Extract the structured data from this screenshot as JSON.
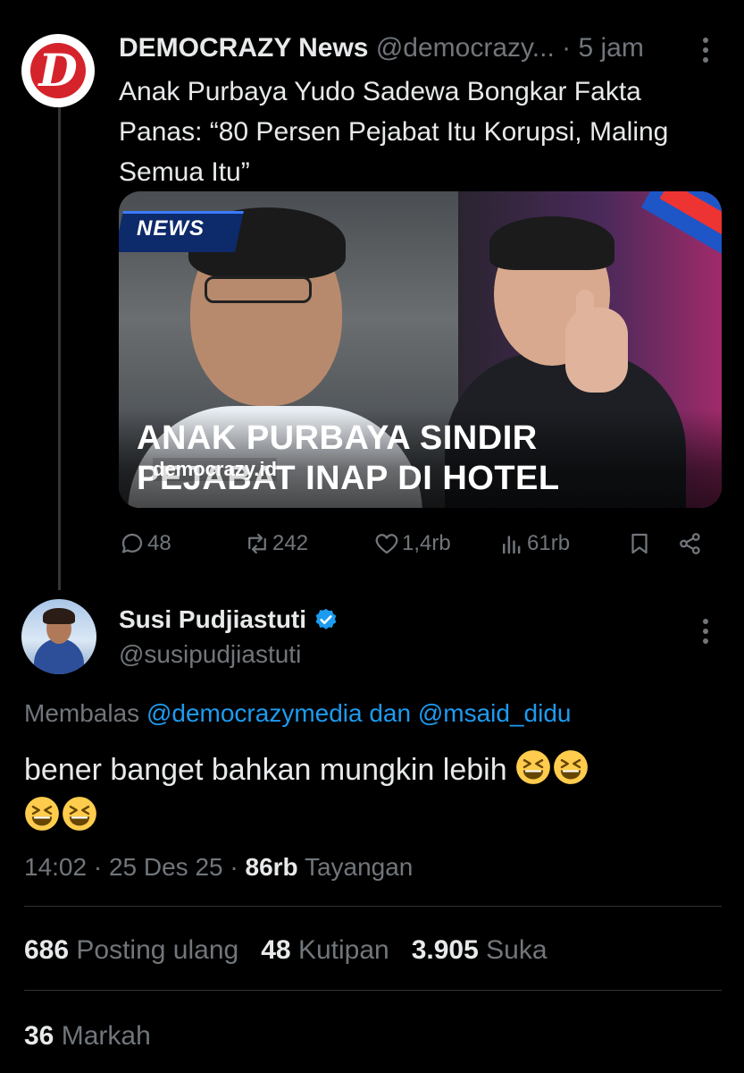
{
  "parent": {
    "display_name": "DEMOCRAZY News",
    "handle": "@democrazy...",
    "separator": "·",
    "time": "5 jam",
    "text": "Anak Purbaya Yudo Sadewa Bongkar Fakta Panas: “80 Persen Pejabat Itu Korupsi, Maling Semua Itu”",
    "avatar_letter": "D",
    "media": {
      "badge": "NEWS",
      "headline_line1": "ANAK PURBAYA SINDIR",
      "headline_line2": "PEJABAT INAP DI HOTEL",
      "watermark": "democrazy.id"
    },
    "actions": {
      "replies": "48",
      "reposts": "242",
      "likes": "1,4rb",
      "views": "61rb"
    }
  },
  "reply": {
    "display_name": "Susi Pudjiastuti",
    "verified": true,
    "handle": "@susipudjiastuti",
    "replying_label": "Membalas",
    "replying_mention1": "@democrazymedia",
    "replying_and": "dan",
    "replying_mention2": "@msaid_didu",
    "text": "bener banget bahkan mungkin lebih",
    "emoji": [
      "grinning-squinting",
      "grinning-squinting",
      "grinning-squinting",
      "grinning-squinting"
    ],
    "time": "14:02",
    "date": "25 Des 25",
    "separator": "·",
    "views_count": "86rb",
    "views_label": "Tayangan"
  },
  "stats": {
    "reposts_count": "686",
    "reposts_label": "Posting ulang",
    "quotes_count": "48",
    "quotes_label": "Kutipan",
    "likes_count": "3.905",
    "likes_label": "Suka",
    "bookmarks_count": "36",
    "bookmarks_label": "Markah"
  },
  "colors": {
    "background": "#000000",
    "text": "#e7e9ea",
    "muted": "#71767b",
    "link": "#1d9bf0",
    "divider": "#2f3336",
    "brand_red": "#d5232b"
  }
}
